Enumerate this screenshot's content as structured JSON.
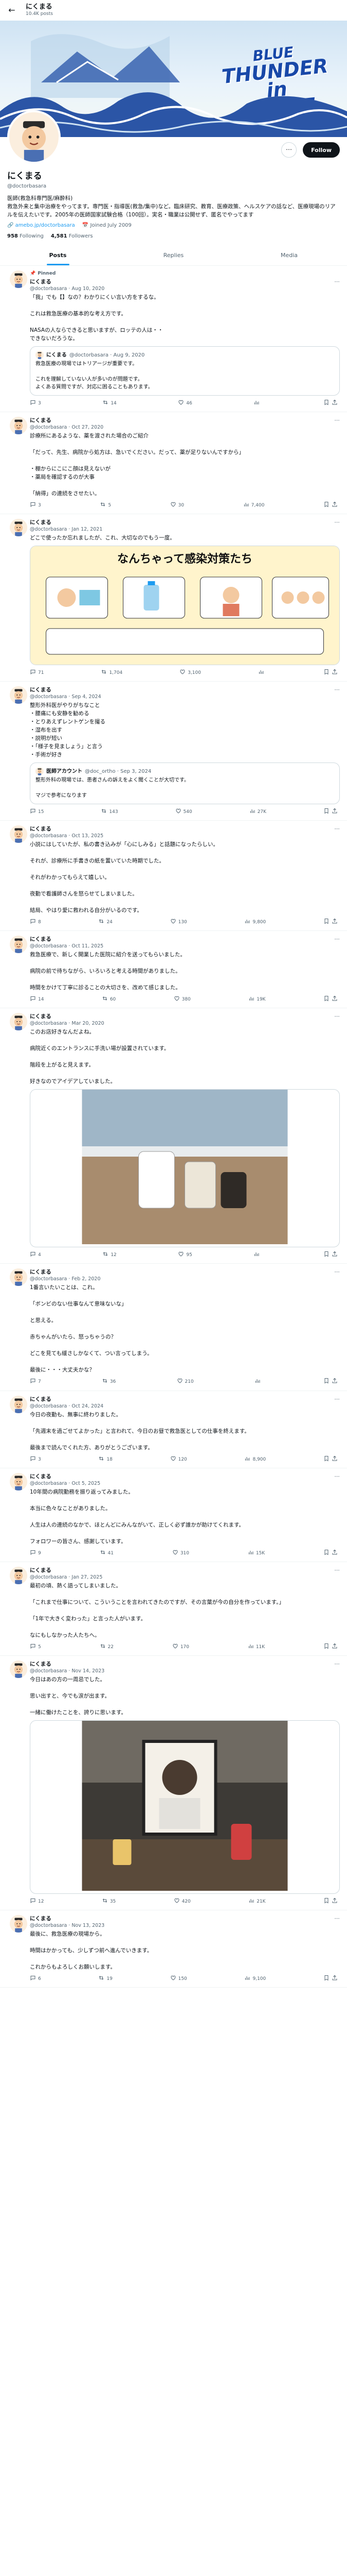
{
  "topbar": {
    "title": "にくまる",
    "post_count": "10.4K posts"
  },
  "banner": {
    "line1": "BLUE",
    "line2": "THUNDER in",
    "line3": "GREAT WAVE"
  },
  "profile": {
    "name": "にくまる",
    "handle": "@doctorbasara",
    "follow_label": "Follow",
    "bio": "医師(救急科専門医/麻酔科)\n救急外来と集中治療をやってます。専門医・指導医(救急/集中)など。臨床研究、教育、医療政策、ヘルスケアの話など、医療現場のリアルを伝えたいです。2005年の医師国家試験合格（100回）。実名・職業は公開せず、匿名でやってます",
    "link": "amebo.jp/doctorbasara",
    "joined": "Joined July 2009",
    "following_count": "958",
    "following_label": "Following",
    "followers_count": "4,581",
    "followers_label": "Followers"
  },
  "tabs": [
    {
      "label": "Posts"
    },
    {
      "label": "Replies"
    },
    {
      "label": "Media"
    }
  ],
  "tweets": [
    {
      "pinned": "Pinned",
      "name": "にくまる",
      "handle": "@doctorbasara",
      "date": "Aug 10, 2020",
      "text": "「我」でも【】なの？わかりにくい言い方をするな。\n\nこれは救急医療の基本的な考え方です。\n\nNASAの人ならできると思いますが、ロッテの人は・・\nできないだろうな。",
      "quote": {
        "name": "にくまる",
        "handle": "@doctorbasara · Aug 9, 2020",
        "text": "救急医療の現場ではトリアージが重要です。\n\nこれを理解していない人が多いのが問題です。\nよくある質問ですが、対応に困ることもあります。"
      },
      "replies": "3",
      "reposts": "14",
      "likes": "46",
      "views": ""
    },
    {
      "name": "にくまる",
      "handle": "@doctorbasara",
      "date": "Oct 27, 2020",
      "text": "診療所にあるような、薬を渡された場合のご紹介\n\n「だって、先生、病院から処方は、急いでください。だって、薬が足りないんですから」\n\n・棚からにこにこ顔は見えないが\n・薬局を確認するのが大事\n\n「納得」の連続をさせたい。",
      "replies": "3",
      "reposts": "5",
      "likes": "30",
      "views": "7,400"
    },
    {
      "name": "にくまる",
      "handle": "@doctorbasara",
      "date": "Jan 12, 2021",
      "text": "どこで使ったか忘れましたが、これ、大切なのでもう一度。",
      "image": "illustration",
      "illus_title": "なんちゃって感染対策たち",
      "replies": "71",
      "reposts": "1,704",
      "likes": "3,100",
      "views": ""
    },
    {
      "name": "にくまる",
      "handle": "@doctorbasara",
      "date": "Sep 4, 2024",
      "text": "整形外科医がやりがちなこと\n・腰痛にも安静を勧める\n・とりあえずレントゲンを撮る\n・湿布を出す\n・説明が短い\n・「様子を見ましょう」と言う\n・手術が好き",
      "quote": {
        "name": "医師アカウント",
        "handle": "@doc_ortho · Sep 3, 2024",
        "text": "整形外科の現場では、患者さんの訴えをよく聞くことが大切です。\n\nマジで参考になります"
      },
      "replies": "15",
      "reposts": "143",
      "likes": "540",
      "views": "27K"
    },
    {
      "name": "にくまる",
      "handle": "@doctorbasara",
      "date": "Oct 13, 2025",
      "text": "小説にはしていたが、私の書き込みが「心にしみる」と話題になったらしい。\n\nそれが、診療所に手書きの紙を置いていた時期でした。\n\nそれがわかってもらえて嬉しい。\n\n夜勤で看護師さんを怒らせてしまいました。\n\n結局、やはり愛に救われる自分がいるのです。",
      "replies": "8",
      "reposts": "24",
      "likes": "130",
      "views": "9,800"
    },
    {
      "name": "にくまる",
      "handle": "@doctorbasara",
      "date": "Oct 11, 2025",
      "text": "救急医療で、新しく開業した医院に紹介を送ってもらいました。\n\n病院の前で待ちながら、いろいろと考える時間がありました。\n\n時間をかけて丁寧に診ることの大切さを、改めて感じました。",
      "replies": "14",
      "reposts": "60",
      "likes": "380",
      "views": "19K"
    },
    {
      "name": "にくまる",
      "handle": "@doctorbasara",
      "date": "Mar 20, 2020",
      "text": "このお店好きなんだよね。\n\n病院近くのエントランスに手洗い場が設置されています。\n\n階段を上がると見えます。\n\n好きなのでアイデアしていました。",
      "image": "photo-cafe",
      "replies": "4",
      "reposts": "12",
      "likes": "95",
      "views": ""
    },
    {
      "name": "にくまる",
      "handle": "@doctorbasara",
      "date": "Feb 2, 2020",
      "text": "1番言いたいことは、これ。\n\n「ボンビのない仕事なんて意味ないな」\n\nと思える。\n\n赤ちゃんがいたら、怒っちゃうの？\n\nどこを見ても緩さしかなくて、つい言ってしまう。\n\n最後に・・・大丈夫かな？",
      "replies": "7",
      "reposts": "36",
      "likes": "210",
      "views": ""
    },
    {
      "name": "にくまる",
      "handle": "@doctorbasara",
      "date": "Oct 24, 2024",
      "text": "今日の夜勤も、無事に終わりました。\n\n「先週末を過ごせてよかった」と言われて、今日のお昼で救急医としての仕事を終えます。\n\n最後まで読んでくれた方、ありがとうございます。",
      "replies": "3",
      "reposts": "18",
      "likes": "120",
      "views": "8,900"
    },
    {
      "name": "にくまる",
      "handle": "@doctorbasara",
      "date": "Oct 5, 2025",
      "text": "10年間の病院勤務を振り返ってみました。\n\n本当に色々なことがありました。\n\n人生は人の連続のなかで、ほとんどにみんながいて、正しく必ず誰かが助けてくれます。\n\nフォロワーの皆さん、感謝しています。",
      "replies": "9",
      "reposts": "41",
      "likes": "310",
      "views": "15K"
    },
    {
      "name": "にくまる",
      "handle": "@doctorbasara",
      "date": "Jan 27, 2025",
      "text": "最初の頃、熱く語ってしまいました。\n\n「これまで仕事について、こういうことを言われてきたのですが、その言葉が今の自分を作っています。」\n\n「1年で大きく変わった」と言った人がいます。\n\nなにもしなかった人たちへ。",
      "replies": "5",
      "reposts": "22",
      "likes": "170",
      "views": "11K"
    },
    {
      "name": "にくまる",
      "handle": "@doctorbasara",
      "date": "Nov 14, 2023",
      "text": "今日はあの方の一周忌でした。\n\n思い出すと、今でも涙が出ます。\n\n一緒に働けたことを、誇りに思います。",
      "image": "photo-memorial",
      "replies": "12",
      "reposts": "35",
      "likes": "420",
      "views": "21K"
    },
    {
      "name": "にくまる",
      "handle": "@doctorbasara",
      "date": "Nov 13, 2023",
      "text": "最後に、救急医療の現場から。\n\n時間はかかっても、少しずつ前へ進んでいきます。\n\nこれからもよろしくお願いします。",
      "replies": "6",
      "reposts": "19",
      "likes": "150",
      "views": "9,100"
    }
  ]
}
